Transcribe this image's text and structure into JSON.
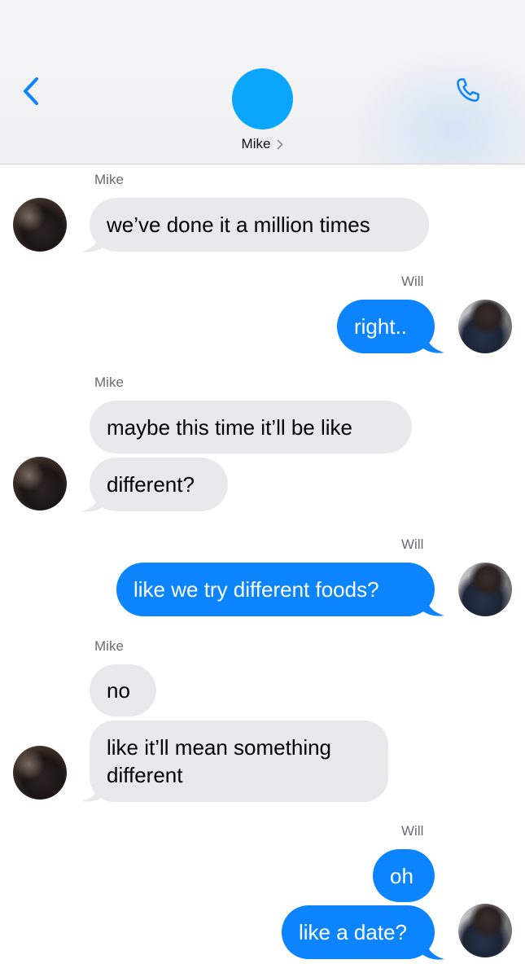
{
  "header": {
    "contact_name": "Mike",
    "avatar_color": "#0aa6fb",
    "back_icon": "chevron-left-icon",
    "call_icon": "phone-icon",
    "accent": "#0b84fe"
  },
  "messages": {
    "g1": {
      "sender": "Mike",
      "b1": "we’ve done it a million times"
    },
    "g2": {
      "sender": "Will",
      "b1": "right.."
    },
    "g3": {
      "sender": "Mike",
      "b1": "maybe this time it’ll be like",
      "b2": "different?"
    },
    "g4": {
      "sender": "Will",
      "b1": "like we try different foods?"
    },
    "g5": {
      "sender": "Mike",
      "b1": "no",
      "b2_l1": "like it’ll mean something",
      "b2_l2": "different"
    },
    "g6": {
      "sender": "Will",
      "b1": "oh",
      "b2": "like a date?"
    }
  }
}
